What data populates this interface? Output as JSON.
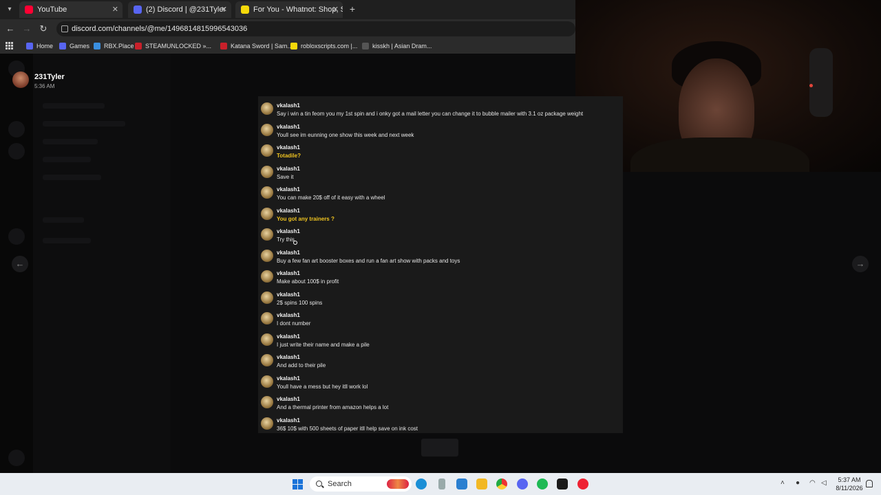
{
  "browser": {
    "tabs": [
      {
        "label": "YouTube",
        "favicon_color": "#ff0033"
      },
      {
        "label": "(2) Discord | @231Tyler",
        "favicon_color": "#5865f2"
      },
      {
        "label": "For You - Whatnot: Shop, Sell, C",
        "favicon_color": "#f5d90a"
      }
    ],
    "url": "discord.com/channels/@me/1496814815996543036",
    "bookmarks": [
      {
        "label": "Home",
        "color": "#5865f2"
      },
      {
        "label": "Games",
        "color": "#5865f2"
      },
      {
        "label": "RBX.Place",
        "color": "#3a8fe0"
      },
      {
        "label": "STEAMUNLOCKED »...",
        "color": "#c8202a"
      },
      {
        "label": "Katana Sword | Sam...",
        "color": "#c8202a"
      },
      {
        "label": "robloxscripts.com |...",
        "color": "#f5d90a"
      },
      {
        "label": "kisskh | Asian Dram...",
        "color": "#555555"
      }
    ]
  },
  "viewer": {
    "username": "231Tyler",
    "time": "5:36 AM"
  },
  "messages": [
    {
      "author": "vkalash1",
      "text": "Say i win a tin feom you my 1st spin and i onky got a mail letter you can change it to bubble mailer with 3.1 oz package weight",
      "highlight": false
    },
    {
      "author": "vkalash1",
      "text": "Youll see im eunning one show this week and next week",
      "highlight": false
    },
    {
      "author": "vkalash1",
      "text": "Totadile?",
      "highlight": true
    },
    {
      "author": "vkalash1",
      "text": "Save it",
      "highlight": false
    },
    {
      "author": "vkalash1",
      "text": "You can make 20$ off of it easy with a wheel",
      "highlight": false
    },
    {
      "author": "vkalash1",
      "text": "You got any trainers ?",
      "highlight": true
    },
    {
      "author": "vkalash1",
      "text": "Try this",
      "highlight": false
    },
    {
      "author": "vkalash1",
      "text": "Buy a few fan art booster boxes and run a fan art show with packs and toys",
      "highlight": false
    },
    {
      "author": "vkalash1",
      "text": "Make about 100$ in profit",
      "highlight": false
    },
    {
      "author": "vkalash1",
      "text": "2$ spins 100 spins",
      "highlight": false
    },
    {
      "author": "vkalash1",
      "text": "I dont number",
      "highlight": false
    },
    {
      "author": "vkalash1",
      "text": "I just write their name and make a pile",
      "highlight": false
    },
    {
      "author": "vkalash1",
      "text": "And add to their pile",
      "highlight": false
    },
    {
      "author": "vkalash1",
      "text": "Youll have a mess but hey itll work lol",
      "highlight": false
    },
    {
      "author": "vkalash1",
      "text": "And a thermal printer from amazon helps a lot",
      "highlight": false
    },
    {
      "author": "vkalash1",
      "text": "36$ 10$ with 500 sheets of paper itll help save on ink cost",
      "highlight": false
    }
  ],
  "taskbar": {
    "search_label": "Search",
    "time": "5:37 AM",
    "date": "8/11/2026"
  },
  "colors": {
    "highlight_text": "#f0c420",
    "panel_bg": "#1a1a1a"
  }
}
